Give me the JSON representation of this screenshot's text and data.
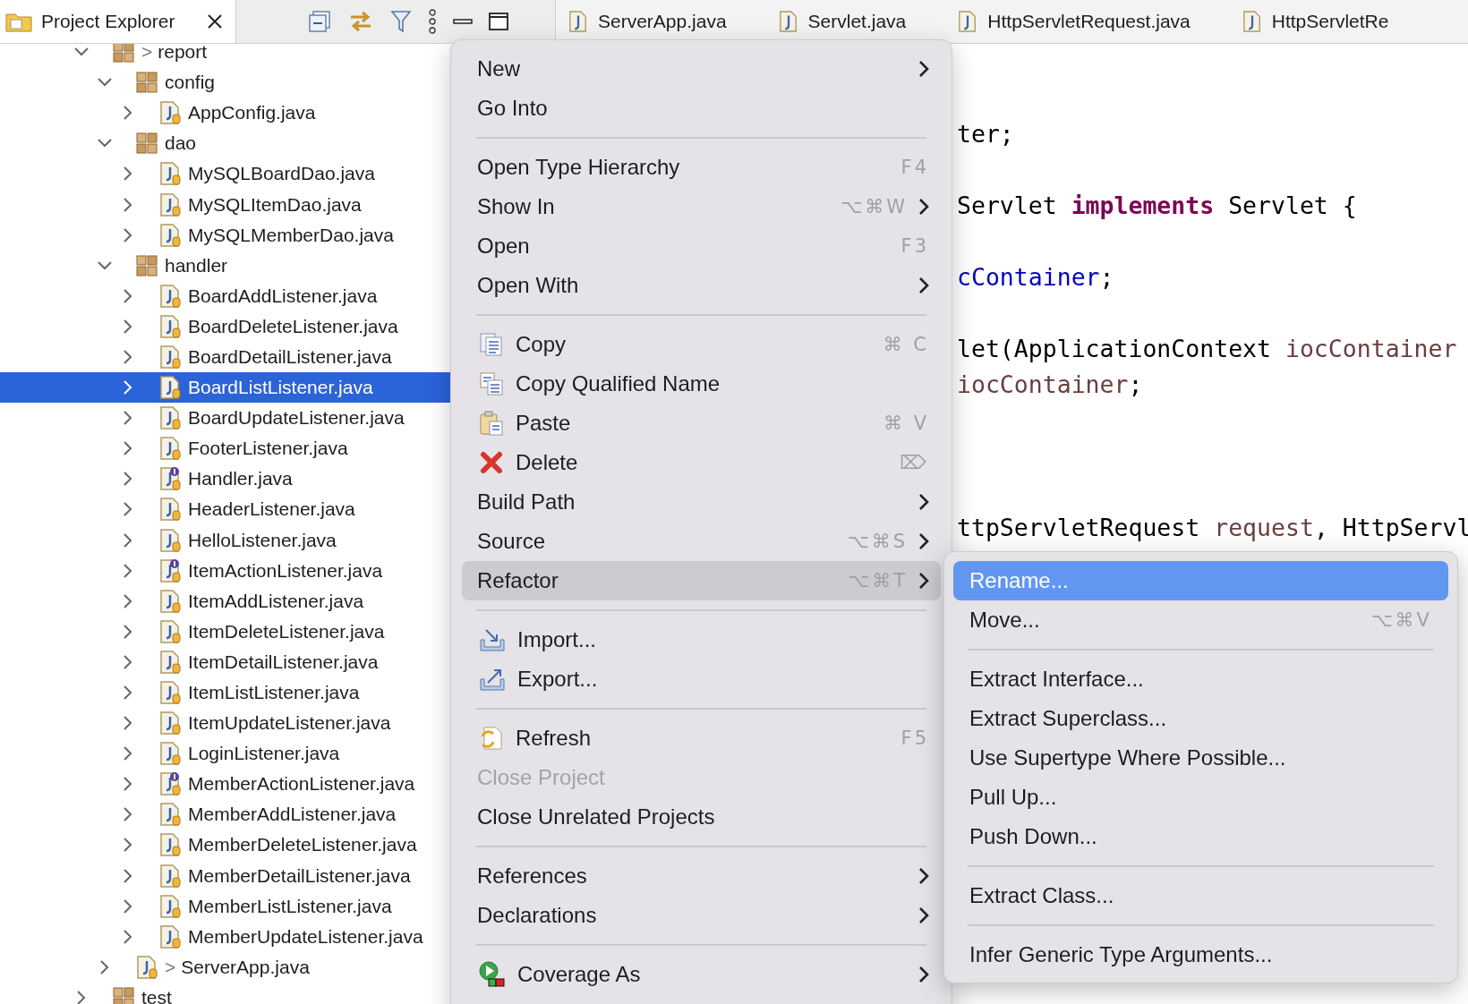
{
  "project_explorer": {
    "title": "Project Explorer",
    "tree": [
      {
        "label": "report",
        "prefix": ">",
        "kind": "package",
        "expanded": true,
        "selected": false,
        "children": [
          {
            "label": "config",
            "kind": "package",
            "expanded": true,
            "selected": false,
            "children": [
              {
                "label": "AppConfig.java",
                "kind": "class",
                "expanded": false,
                "selected": false
              }
            ]
          },
          {
            "label": "dao",
            "kind": "package",
            "expanded": true,
            "selected": false,
            "children": [
              {
                "label": "MySQLBoardDao.java",
                "kind": "class",
                "expanded": false,
                "selected": false
              },
              {
                "label": "MySQLItemDao.java",
                "kind": "class",
                "expanded": false,
                "selected": false
              },
              {
                "label": "MySQLMemberDao.java",
                "kind": "class",
                "expanded": false,
                "selected": false
              }
            ]
          },
          {
            "label": "handler",
            "kind": "package",
            "expanded": true,
            "selected": false,
            "children": [
              {
                "label": "BoardAddListener.java",
                "kind": "class",
                "expanded": false,
                "selected": false
              },
              {
                "label": "BoardDeleteListener.java",
                "kind": "class",
                "expanded": false,
                "selected": false
              },
              {
                "label": "BoardDetailListener.java",
                "kind": "class",
                "expanded": false,
                "selected": false
              },
              {
                "label": "BoardListListener.java",
                "kind": "class",
                "expanded": false,
                "selected": true
              },
              {
                "label": "BoardUpdateListener.java",
                "kind": "class",
                "expanded": false,
                "selected": false
              },
              {
                "label": "FooterListener.java",
                "kind": "class",
                "expanded": false,
                "selected": false
              },
              {
                "label": "Handler.java",
                "kind": "interface",
                "expanded": false,
                "selected": false
              },
              {
                "label": "HeaderListener.java",
                "kind": "class",
                "expanded": false,
                "selected": false
              },
              {
                "label": "HelloListener.java",
                "kind": "class",
                "expanded": false,
                "selected": false
              },
              {
                "label": "ItemActionListener.java",
                "kind": "interface",
                "expanded": false,
                "selected": false
              },
              {
                "label": "ItemAddListener.java",
                "kind": "class",
                "expanded": false,
                "selected": false
              },
              {
                "label": "ItemDeleteListener.java",
                "kind": "class",
                "expanded": false,
                "selected": false
              },
              {
                "label": "ItemDetailListener.java",
                "kind": "class",
                "expanded": false,
                "selected": false
              },
              {
                "label": "ItemListListener.java",
                "kind": "class",
                "expanded": false,
                "selected": false
              },
              {
                "label": "ItemUpdateListener.java",
                "kind": "class",
                "expanded": false,
                "selected": false
              },
              {
                "label": "LoginListener.java",
                "kind": "class",
                "expanded": false,
                "selected": false
              },
              {
                "label": "MemberActionListener.java",
                "kind": "interface",
                "expanded": false,
                "selected": false
              },
              {
                "label": "MemberAddListener.java",
                "kind": "class",
                "expanded": false,
                "selected": false
              },
              {
                "label": "MemberDeleteListener.java",
                "kind": "class",
                "expanded": false,
                "selected": false
              },
              {
                "label": "MemberDetailListener.java",
                "kind": "class",
                "expanded": false,
                "selected": false
              },
              {
                "label": "MemberListListener.java",
                "kind": "class",
                "expanded": false,
                "selected": false
              },
              {
                "label": "MemberUpdateListener.java",
                "kind": "class",
                "expanded": false,
                "selected": false
              }
            ]
          },
          {
            "label": "ServerApp.java",
            "prefix": ">",
            "kind": "class",
            "expanded": false,
            "selected": false
          }
        ]
      },
      {
        "label": "test",
        "kind": "package",
        "expanded": false,
        "selected": false
      }
    ]
  },
  "editor_tabs": [
    {
      "label": "ServerApp.java"
    },
    {
      "label": "Servlet.java"
    },
    {
      "label": "HttpServletRequest.java"
    },
    {
      "label": "HttpServletRe"
    }
  ],
  "code_lines": [
    {
      "tokens": [
        {
          "text": "ter;",
          "kind": "plain"
        }
      ]
    },
    {
      "tokens": [
        {
          "text": "Servlet ",
          "kind": "plain"
        },
        {
          "text": "implements",
          "kind": "keyword"
        },
        {
          "text": " Servlet {",
          "kind": "plain"
        }
      ]
    },
    {
      "tokens": [
        {
          "text": "cContainer",
          "kind": "field"
        },
        {
          "text": ";",
          "kind": "plain"
        }
      ]
    },
    {
      "tokens": [
        {
          "text": "let(ApplicationContext ",
          "kind": "plain"
        },
        {
          "text": "iocContainer",
          "kind": "param"
        }
      ]
    },
    {
      "tokens": [
        {
          "text": "iocContainer",
          "kind": "param"
        },
        {
          "text": ";",
          "kind": "plain"
        }
      ]
    },
    {
      "tokens": [
        {
          "text": "ttpServletRequest ",
          "kind": "plain"
        },
        {
          "text": "request",
          "kind": "param"
        },
        {
          "text": ", HttpServl",
          "kind": "plain"
        }
      ]
    }
  ],
  "context_menu": {
    "items": [
      {
        "kind": "item",
        "label": "New",
        "submenu": true,
        "selected": false,
        "disabled": false
      },
      {
        "kind": "item",
        "label": "Go Into",
        "submenu": false,
        "selected": false,
        "disabled": false
      },
      {
        "kind": "separator"
      },
      {
        "kind": "item",
        "label": "Open Type Hierarchy",
        "shortcut": "F4",
        "submenu": false,
        "selected": false,
        "disabled": false
      },
      {
        "kind": "item",
        "label": "Show In",
        "shortcut": "⌥⌘W",
        "submenu": true,
        "selected": false,
        "disabled": false
      },
      {
        "kind": "item",
        "label": "Open",
        "shortcut": "F3",
        "submenu": false,
        "selected": false,
        "disabled": false
      },
      {
        "kind": "item",
        "label": "Open With",
        "submenu": true,
        "selected": false,
        "disabled": false
      },
      {
        "kind": "separator"
      },
      {
        "kind": "item",
        "label": "Copy",
        "shortcut": "⌘ C",
        "submenu": false,
        "selected": false,
        "disabled": false
      },
      {
        "kind": "item",
        "label": "Copy Qualified Name",
        "submenu": false,
        "selected": false,
        "disabled": false
      },
      {
        "kind": "item",
        "label": "Paste",
        "shortcut": "⌘ V",
        "submenu": false,
        "selected": false,
        "disabled": false
      },
      {
        "kind": "item",
        "label": "Delete",
        "shortcut": "⌦",
        "submenu": false,
        "selected": false,
        "disabled": false
      },
      {
        "kind": "item",
        "label": "Build Path",
        "submenu": true,
        "selected": false,
        "disabled": false
      },
      {
        "kind": "item",
        "label": "Source",
        "shortcut": "⌥⌘S",
        "submenu": true,
        "selected": false,
        "disabled": false
      },
      {
        "kind": "item",
        "label": "Refactor",
        "shortcut": "⌥⌘T",
        "submenu": true,
        "selected": true,
        "disabled": false
      },
      {
        "kind": "separator"
      },
      {
        "kind": "item",
        "label": "Import...",
        "submenu": false,
        "selected": false,
        "disabled": false
      },
      {
        "kind": "item",
        "label": "Export...",
        "submenu": false,
        "selected": false,
        "disabled": false
      },
      {
        "kind": "separator"
      },
      {
        "kind": "item",
        "label": "Refresh",
        "shortcut": "F5",
        "submenu": false,
        "selected": false,
        "disabled": false
      },
      {
        "kind": "item",
        "label": "Close Project",
        "submenu": false,
        "selected": false,
        "disabled": true
      },
      {
        "kind": "item",
        "label": "Close Unrelated Projects",
        "submenu": false,
        "selected": false,
        "disabled": false
      },
      {
        "kind": "separator"
      },
      {
        "kind": "item",
        "label": "References",
        "submenu": true,
        "selected": false,
        "disabled": false
      },
      {
        "kind": "item",
        "label": "Declarations",
        "submenu": true,
        "selected": false,
        "disabled": false
      },
      {
        "kind": "separator"
      },
      {
        "kind": "item",
        "label": "Coverage As",
        "submenu": true,
        "selected": false,
        "disabled": false
      }
    ]
  },
  "refactor_submenu": {
    "items": [
      {
        "kind": "item",
        "label": "Rename...",
        "selected": true
      },
      {
        "kind": "item",
        "label": "Move...",
        "shortcut": "⌥⌘V",
        "selected": false
      },
      {
        "kind": "separator"
      },
      {
        "kind": "item",
        "label": "Extract Interface...",
        "selected": false
      },
      {
        "kind": "item",
        "label": "Extract Superclass...",
        "selected": false
      },
      {
        "kind": "item",
        "label": "Use Supertype Where Possible...",
        "selected": false
      },
      {
        "kind": "item",
        "label": "Pull Up...",
        "selected": false
      },
      {
        "kind": "item",
        "label": "Push Down...",
        "selected": false
      },
      {
        "kind": "separator"
      },
      {
        "kind": "item",
        "label": "Extract Class...",
        "selected": false
      },
      {
        "kind": "separator"
      },
      {
        "kind": "item",
        "label": "Infer Generic Type Arguments...",
        "selected": false
      }
    ]
  }
}
